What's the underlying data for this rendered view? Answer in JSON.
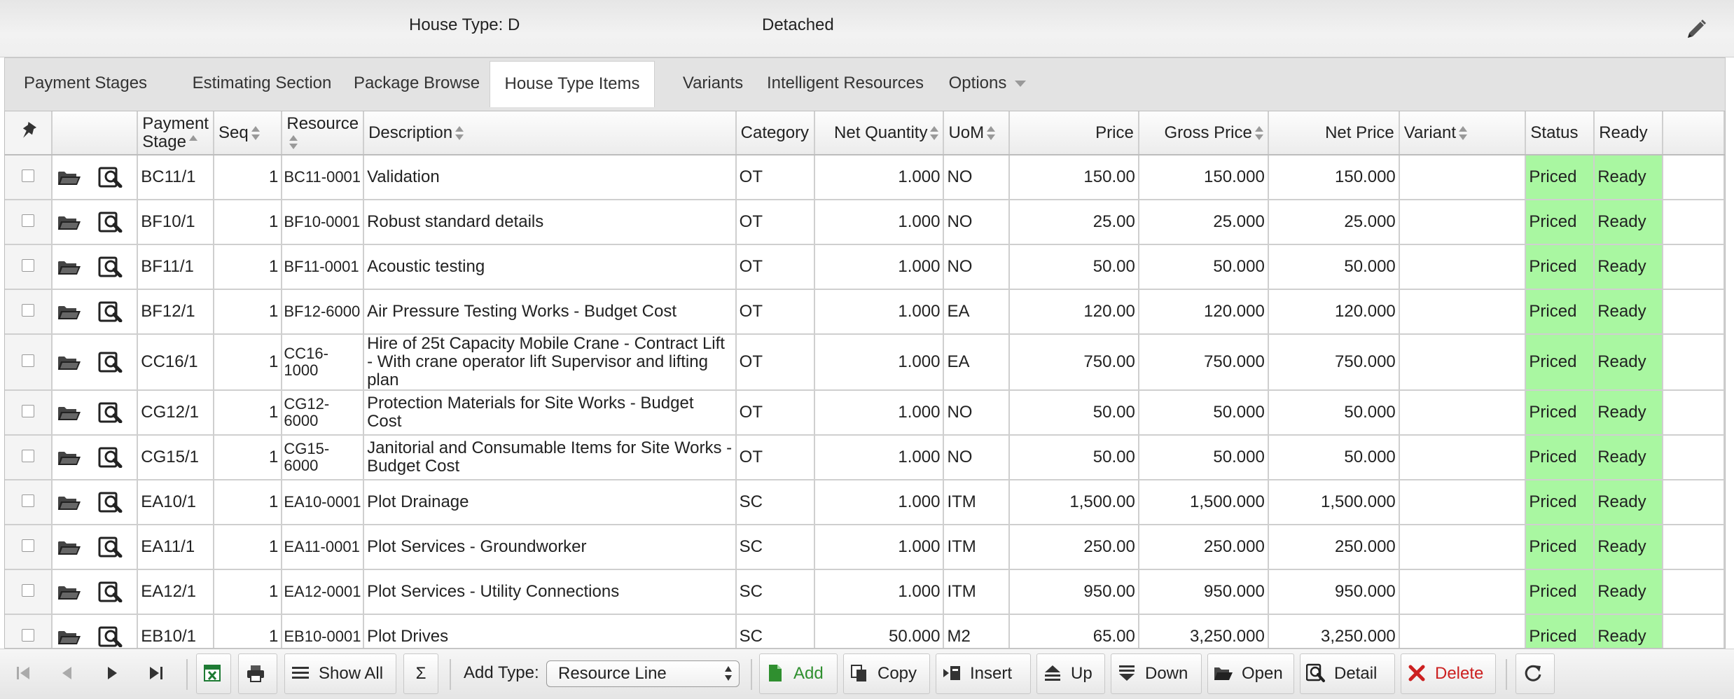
{
  "header": {
    "house_type": "House Type: D",
    "detached": "Detached"
  },
  "tabs": [
    {
      "label": "Payment Stages"
    },
    {
      "label": "Estimating Section"
    },
    {
      "label": "Package Browse"
    },
    {
      "label": "House Type Items",
      "active": true
    },
    {
      "label": "Variants"
    },
    {
      "label": "Intelligent Resources"
    },
    {
      "label": "Options"
    }
  ],
  "grid": {
    "columns": {
      "payment_stage": "Payment Stage",
      "seq": "Seq",
      "resource": "Resource",
      "description": "Description",
      "category": "Category",
      "net_quantity": "Net Quantity",
      "uom": "UoM",
      "price": "Price",
      "gross_price": "Gross Price",
      "net_price": "Net Price",
      "variant": "Variant",
      "status": "Status",
      "ready": "Ready"
    },
    "rows": [
      {
        "stage": "BC11/1",
        "seq": "1",
        "resource": "BC11-0001",
        "description": "Validation",
        "category": "OT",
        "net_qty": "1.000",
        "uom": "NO",
        "price": "150.00",
        "gross": "150.000",
        "net": "150.000",
        "variant": "",
        "status": "Priced",
        "ready": "Ready"
      },
      {
        "stage": "BF10/1",
        "seq": "1",
        "resource": "BF10-0001",
        "description": "Robust standard details",
        "category": "OT",
        "net_qty": "1.000",
        "uom": "NO",
        "price": "25.00",
        "gross": "25.000",
        "net": "25.000",
        "variant": "",
        "status": "Priced",
        "ready": "Ready"
      },
      {
        "stage": "BF11/1",
        "seq": "1",
        "resource": "BF11-0001",
        "description": "Acoustic testing",
        "category": "OT",
        "net_qty": "1.000",
        "uom": "NO",
        "price": "50.00",
        "gross": "50.000",
        "net": "50.000",
        "variant": "",
        "status": "Priced",
        "ready": "Ready"
      },
      {
        "stage": "BF12/1",
        "seq": "1",
        "resource": "BF12-6000",
        "description": "Air Pressure Testing Works - Budget Cost",
        "category": "OT",
        "net_qty": "1.000",
        "uom": "EA",
        "price": "120.00",
        "gross": "120.000",
        "net": "120.000",
        "variant": "",
        "status": "Priced",
        "ready": "Ready"
      },
      {
        "stage": "CC16/1",
        "seq": "1",
        "resource": "CC16-1000",
        "description": "Hire of 25t Capacity Mobile Crane - Contract Lift - With crane operator lift Supervisor and lifting plan",
        "category": "OT",
        "net_qty": "1.000",
        "uom": "EA",
        "price": "750.00",
        "gross": "750.000",
        "net": "750.000",
        "variant": "",
        "status": "Priced",
        "ready": "Ready"
      },
      {
        "stage": "CG12/1",
        "seq": "1",
        "resource": "CG12-6000",
        "description": "Protection Materials for Site Works - Budget Cost",
        "category": "OT",
        "net_qty": "1.000",
        "uom": "NO",
        "price": "50.00",
        "gross": "50.000",
        "net": "50.000",
        "variant": "",
        "status": "Priced",
        "ready": "Ready"
      },
      {
        "stage": "CG15/1",
        "seq": "1",
        "resource": "CG15-6000",
        "description": "Janitorial and Consumable Items for Site Works - Budget Cost",
        "category": "OT",
        "net_qty": "1.000",
        "uom": "NO",
        "price": "50.00",
        "gross": "50.000",
        "net": "50.000",
        "variant": "",
        "status": "Priced",
        "ready": "Ready"
      },
      {
        "stage": "EA10/1",
        "seq": "1",
        "resource": "EA10-0001",
        "description": "Plot Drainage",
        "category": "SC",
        "net_qty": "1.000",
        "uom": "ITM",
        "price": "1,500.00",
        "gross": "1,500.000",
        "net": "1,500.000",
        "variant": "",
        "status": "Priced",
        "ready": "Ready"
      },
      {
        "stage": "EA11/1",
        "seq": "1",
        "resource": "EA11-0001",
        "description": "Plot Services - Groundworker",
        "category": "SC",
        "net_qty": "1.000",
        "uom": "ITM",
        "price": "250.00",
        "gross": "250.000",
        "net": "250.000",
        "variant": "",
        "status": "Priced",
        "ready": "Ready"
      },
      {
        "stage": "EA12/1",
        "seq": "1",
        "resource": "EA12-0001",
        "description": "Plot Services - Utility Connections",
        "category": "SC",
        "net_qty": "1.000",
        "uom": "ITM",
        "price": "950.00",
        "gross": "950.000",
        "net": "950.000",
        "variant": "",
        "status": "Priced",
        "ready": "Ready"
      },
      {
        "stage": "EB10/1",
        "seq": "1",
        "resource": "EB10-0001",
        "description": "Plot Drives",
        "category": "SC",
        "net_qty": "50.000",
        "uom": "M2",
        "price": "65.00",
        "gross": "3,250.000",
        "net": "3,250.000",
        "variant": "",
        "status": "Priced",
        "ready": "Ready"
      }
    ]
  },
  "toolbar": {
    "show_all": "Show All",
    "sigma": "Σ",
    "add_type_label": "Add Type:",
    "add_type_value": "Resource Line",
    "add": "Add",
    "copy": "Copy",
    "insert": "Insert",
    "up": "Up",
    "down": "Down",
    "open": "Open",
    "detail": "Detail",
    "delete": "Delete"
  },
  "colors": {
    "ready_green": "#a9f7a1",
    "add_green": "#2f8f2f",
    "delete_red": "#cc2020",
    "excel_green": "#1e7b34"
  }
}
